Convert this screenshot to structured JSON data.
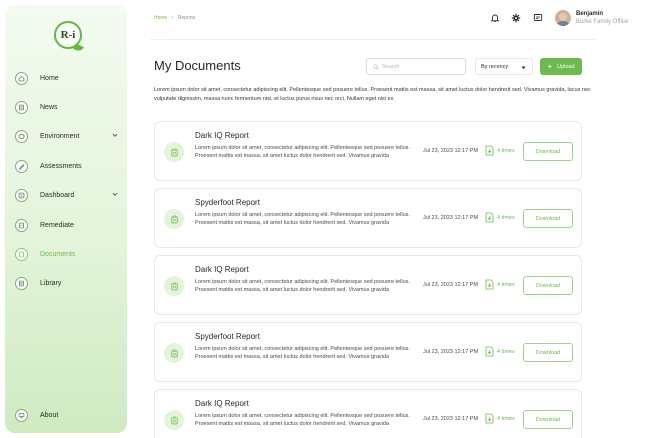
{
  "brand": {
    "logo_text": "R-i",
    "accent": "#6dbb4e"
  },
  "breadcrumb": {
    "home": "Home",
    "separator": "›",
    "current": "Reports"
  },
  "user": {
    "name": "Benjamin",
    "org": "Burke Family Office"
  },
  "sidebar": {
    "items": [
      {
        "label": "Home",
        "icon": "home-icon"
      },
      {
        "label": "News",
        "icon": "news-icon"
      },
      {
        "label": "Environment",
        "icon": "environment-icon",
        "expandable": true
      },
      {
        "label": "Assessments",
        "icon": "assessments-icon"
      },
      {
        "label": "Dashboard",
        "icon": "dashboard-icon",
        "expandable": true
      },
      {
        "label": "Remediate",
        "icon": "remediate-icon"
      },
      {
        "label": "Documents",
        "icon": "documents-icon",
        "active": true
      },
      {
        "label": "Library",
        "icon": "library-icon"
      }
    ],
    "about": {
      "label": "About",
      "icon": "monitor-icon"
    }
  },
  "main": {
    "title": "My Documents",
    "search_placeholder": "Search",
    "sort_value": "By recency",
    "upload_label": "Upload",
    "intro": "Lorem ipsum dolor sit amet, consectetur adipiscing elit. Pellentesque sed posuere tellus. Proesent mattis est massa, sit amet luctus dolor hendrerit sed. Vivamus gravida, lacus nec vulputate dignissim, massa nunc fermentum nisi, et luctus purus risus nec orci. Nullam eget nisi ex.",
    "documents": [
      {
        "title": "Dark IQ Report",
        "desc": "Lorem ipsum dolor sit amet, consectetur adipiscing elit. Pellentesque sed posuere tellus. Proesent mattis est massa, sit amet luctus dolor hendrerit sed. Vivamus gravida",
        "date": "Jul 23, 2023 12:17 PM",
        "times": "4 times",
        "download": "Download"
      },
      {
        "title": "Spyderfoot Report",
        "desc": "Lorem ipsum dolor sit amet, consectetur adipiscing elit. Pellentesque sed posuere tellus. Proesent mattis est massa, sit amet luctus dolor hendrerit sed. Vivamus gravida",
        "date": "Jul 23, 2023 12:17 PM",
        "times": "4 times",
        "download": "Download"
      },
      {
        "title": "Dark IQ Report",
        "desc": "Lorem ipsum dolor sit amet, consectetur adipiscing elit. Pellentesque sed posuere tellus. Proesent mattis est massa, sit amet luctus dolor hendrerit sed. Vivamus gravida",
        "date": "Jul 23, 2023 12:17 PM",
        "times": "4 times",
        "download": "Download"
      },
      {
        "title": "Spyderfoot Report",
        "desc": "Lorem ipsum dolor sit amet, consectetur adipiscing elit. Pellentesque sed posuere tellus. Proesent mattis est massa, sit amet luctus dolor hendrerit sed. Vivamus gravida",
        "date": "Jul 23, 2023 12:17 PM",
        "times": "4 times",
        "download": "Download"
      },
      {
        "title": "Dark IQ Report",
        "desc": "Lorem ipsum dolor sit amet, consectetur adipiscing elit. Pellentesque sed posuere tellus. Proesent mattis est massa, sit amet luctus dolor hendrerit sed. Vivamus gravida",
        "date": "Jul 23, 2023 12:17 PM",
        "times": "4 times",
        "download": "Download"
      }
    ]
  }
}
